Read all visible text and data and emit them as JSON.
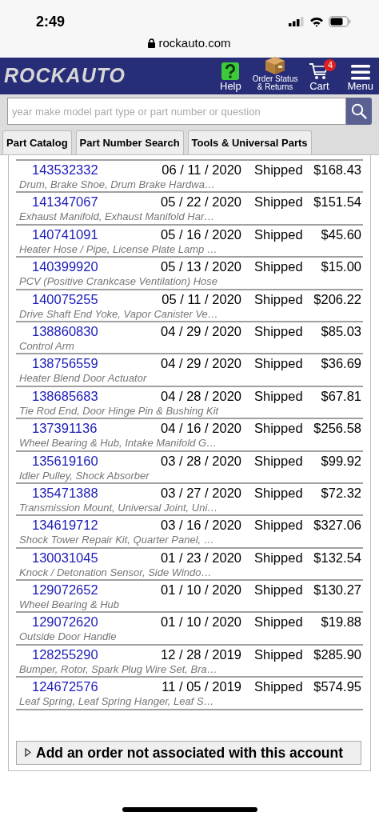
{
  "status_bar": {
    "time": "2:49",
    "url": "rockauto.com"
  },
  "nav": {
    "logo": "ROCKAUTO",
    "items": [
      {
        "kind": "help",
        "label": "Help"
      },
      {
        "kind": "orders",
        "label": "Order Status\n& Returns"
      },
      {
        "kind": "cart",
        "label": "Cart",
        "badge": "4"
      },
      {
        "kind": "menu",
        "label": "Menu"
      }
    ]
  },
  "search": {
    "placeholder": "year make model part type or part number or question"
  },
  "tabs": [
    {
      "label": "Part Catalog",
      "selected": false
    },
    {
      "label": "Part Number Search",
      "selected": false
    },
    {
      "label": "Tools & Universal Parts",
      "selected": false
    }
  ],
  "orders": [
    {
      "number": "143532332",
      "date": "06 / 11 / 2020",
      "status": "Shipped",
      "total": "$168.43",
      "parts": "Drum, Brake Shoe, Drum Brake Hardwa…"
    },
    {
      "number": "141347067",
      "date": "05 / 22 / 2020",
      "status": "Shipped",
      "total": "$151.54",
      "parts": "Exhaust Manifold, Exhaust Manifold Har…"
    },
    {
      "number": "140741091",
      "date": "05 / 16 / 2020",
      "status": "Shipped",
      "total": "$45.60",
      "parts": "Heater Hose / Pipe, License Plate Lamp …"
    },
    {
      "number": "140399920",
      "date": "05 / 13 / 2020",
      "status": "Shipped",
      "total": "$15.00",
      "parts": "PCV (Positive Crankcase Ventilation) Hose"
    },
    {
      "number": "140075255",
      "date": "05 / 11 / 2020",
      "status": "Shipped",
      "total": "$206.22",
      "parts": "Drive Shaft End Yoke, Vapor Canister Ve…"
    },
    {
      "number": "138860830",
      "date": "04 / 29 / 2020",
      "status": "Shipped",
      "total": "$85.03",
      "parts": "Control Arm"
    },
    {
      "number": "138756559",
      "date": "04 / 29 / 2020",
      "status": "Shipped",
      "total": "$36.69",
      "parts": "Heater Blend Door Actuator"
    },
    {
      "number": "138685683",
      "date": "04 / 28 / 2020",
      "status": "Shipped",
      "total": "$67.81",
      "parts": "Tie Rod End, Door Hinge Pin & Bushing Kit"
    },
    {
      "number": "137391136",
      "date": "04 / 16 / 2020",
      "status": "Shipped",
      "total": "$256.58",
      "parts": "Wheel Bearing & Hub, Intake Manifold G…"
    },
    {
      "number": "135619160",
      "date": "03 / 28 / 2020",
      "status": "Shipped",
      "total": "$99.92",
      "parts": "Idler Pulley, Shock Absorber"
    },
    {
      "number": "135471388",
      "date": "03 / 27 / 2020",
      "status": "Shipped",
      "total": "$72.32",
      "parts": "Transmission Mount, Universal Joint, Uni…"
    },
    {
      "number": "134619712",
      "date": "03 / 16 / 2020",
      "status": "Shipped",
      "total": "$327.06",
      "parts": "Shock Tower Repair Kit, Quarter Panel, …"
    },
    {
      "number": "130031045",
      "date": "01 / 23 / 2020",
      "status": "Shipped",
      "total": "$132.54",
      "parts": "Knock / Detonation Sensor, Side Windo…"
    },
    {
      "number": "129072652",
      "date": "01 / 10 / 2020",
      "status": "Shipped",
      "total": "$130.27",
      "parts": "Wheel Bearing & Hub"
    },
    {
      "number": "129072620",
      "date": "01 / 10 / 2020",
      "status": "Shipped",
      "total": "$19.88",
      "parts": "Outside Door Handle"
    },
    {
      "number": "128255290",
      "date": "12 / 28 / 2019",
      "status": "Shipped",
      "total": "$285.90",
      "parts": "Bumper, Rotor, Spark Plug Wire Set, Bra…"
    },
    {
      "number": "124672576",
      "date": "11 / 05 / 2019",
      "status": "Shipped",
      "total": "$574.95",
      "parts": "Leaf Spring, Leaf Spring Hanger, Leaf S…"
    }
  ],
  "add_order_button": "Add an order not associated with this account"
}
